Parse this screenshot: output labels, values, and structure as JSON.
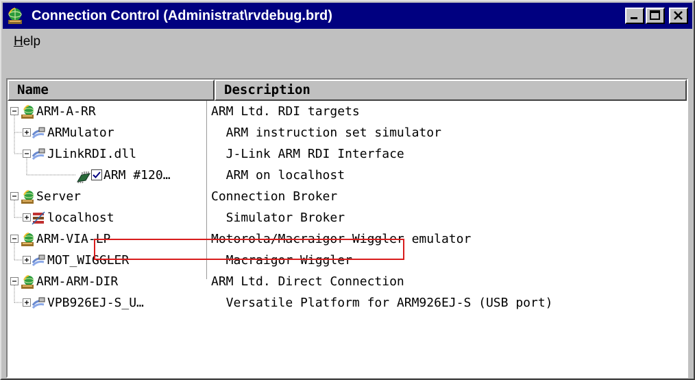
{
  "window": {
    "title": "Connection Control (Administrat\\rvdebug.brd)",
    "buttons": [
      "minimize",
      "maximize",
      "close"
    ]
  },
  "menu": {
    "help_label": "Help",
    "help_accel": "H"
  },
  "columns": {
    "name": "Name",
    "description": "Description"
  },
  "rows": [
    {
      "name": "ARM-A-RR",
      "desc": "ARM Ltd. RDI targets",
      "level": 0,
      "toggle": "minus",
      "icon": "network-globe-icon",
      "checked": null
    },
    {
      "name": "ARMulator",
      "desc": "  ARM instruction set simulator",
      "level": 1,
      "toggle": "plus",
      "icon": "driver-icon",
      "checked": null
    },
    {
      "name": "JLinkRDI.dll",
      "desc": "  J-Link ARM RDI Interface",
      "level": 1,
      "toggle": "minus",
      "icon": "driver-icon",
      "checked": null
    },
    {
      "name": "ARM #120…",
      "desc": "  ARM on localhost",
      "level": 2,
      "toggle": null,
      "icon": "chip-icon",
      "checked": true
    },
    {
      "name": "Server",
      "desc": "Connection Broker",
      "level": 0,
      "toggle": "minus",
      "icon": "network-globe-icon",
      "checked": null
    },
    {
      "name": "localhost",
      "desc": "  Simulator Broker",
      "level": 1,
      "toggle": "plus",
      "icon": "broker-icon",
      "checked": null
    },
    {
      "name": "ARM-VIA-LP",
      "desc": "Motorola/Macraigor Wiggler emulator",
      "level": 0,
      "toggle": "minus",
      "icon": "network-globe-icon",
      "checked": null
    },
    {
      "name": "MOT_WIGGLER",
      "desc": "  Macraigor Wiggler",
      "level": 1,
      "toggle": "plus",
      "icon": "driver-icon",
      "checked": null
    },
    {
      "name": "ARM-ARM-DIR",
      "desc": "ARM Ltd. Direct Connection",
      "level": 0,
      "toggle": "minus",
      "icon": "network-globe-icon",
      "checked": null
    },
    {
      "name": "VPB926EJ-S_U…",
      "desc": "  Versatile Platform for ARM926EJ-S (USB port)",
      "level": 1,
      "toggle": "plus",
      "icon": "driver-icon",
      "checked": null
    }
  ],
  "colors": {
    "titlebar": "#000080",
    "highlight_box": "#d81c1c",
    "window_face": "#c0c0c0"
  }
}
